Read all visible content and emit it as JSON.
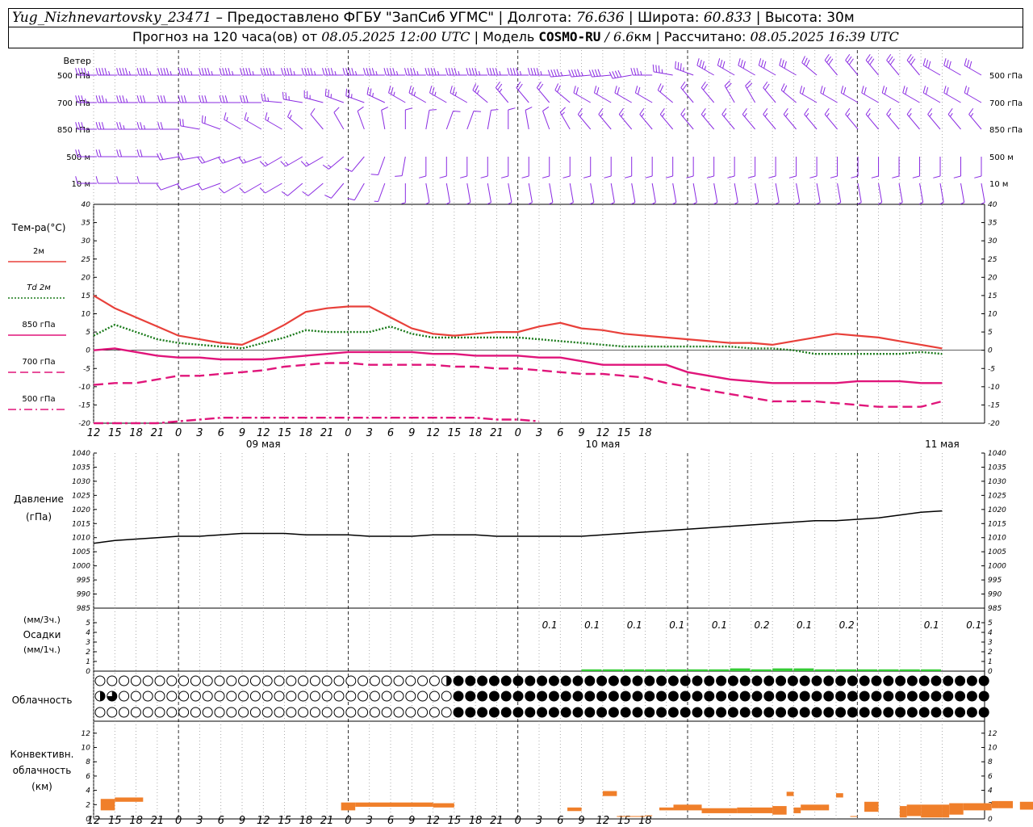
{
  "header": {
    "station": "Yug_Nizhnevartovsky_23471",
    "dash": "–",
    "provided_by": "Предоставлено ФГБУ \"ЗапСиб УГМС\"",
    "sep": "|",
    "lon_label": "Долгота:",
    "lon_value": "76.636",
    "lat_label": "Широта:",
    "lat_value": "60.833",
    "alt_label": "Высота:",
    "alt_value": "30м",
    "forecast_label": "Прогноз на 120 часа(ов) от",
    "forecast_from": "08.05.2025 12:00 UTC",
    "model_label": "Модель",
    "model_name": "COSMO-RU",
    "model_res": "/ 6.6",
    "model_res_unit": "км",
    "calc_label": "Рассчитано:",
    "calc_value": "08.05.2025 16:39 UTC"
  },
  "wind_panel": {
    "title": "Ветер",
    "levels": [
      "500 гПа",
      "700 гПа",
      "850 гПа",
      "500 м",
      "10 м"
    ]
  },
  "time_axis": {
    "hour_labels": [
      "12",
      "15",
      "18",
      "21",
      "0",
      "3",
      "6",
      "9",
      "12",
      "15",
      "18",
      "21",
      "0",
      "3",
      "6",
      "9",
      "12",
      "15",
      "18",
      "21",
      "0",
      "3",
      "6",
      "9",
      "12",
      "15",
      "18"
    ],
    "day_labels": [
      "09 мая",
      "10 мая",
      "11 мая"
    ]
  },
  "temp_legend": {
    "title": "Тем-ра(°С)",
    "items": [
      {
        "label": "2м",
        "color": "#e8403a",
        "dash": "solid"
      },
      {
        "label": "Td 2м",
        "color": "#1a7a1a",
        "dash": "dotted"
      },
      {
        "label": "850 гПа",
        "color": "#e0157a",
        "dash": "solid"
      },
      {
        "label": "700 гПа",
        "color": "#e0157a",
        "dash": "dash"
      },
      {
        "label": "500 гПа",
        "color": "#e0157a",
        "dash": "dashdot"
      }
    ]
  },
  "pressure_label_1": "Давление",
  "pressure_label_2": "(гПа)",
  "precip_labels": [
    "(мм/3ч.)",
    "Осадки",
    "(мм/1ч.)"
  ],
  "cloud_label": "Облачность",
  "conv_labels": [
    "Конвективн.",
    "облачность",
    "(км)"
  ],
  "colors": {
    "wind": "#8a2be2",
    "t2m": "#e8403a",
    "td2m": "#1a7a1a",
    "pmag": "#e0157a",
    "pressure": "#000000",
    "precip": "#33cc33",
    "conv": "#f07f2a"
  },
  "chart_data": [
    {
      "type": "line",
      "title": "Тем-ра(°С)",
      "x": [
        0,
        3,
        6,
        9,
        12,
        15,
        18,
        21,
        24,
        27,
        30,
        33,
        36,
        39,
        42,
        45,
        48,
        51,
        54,
        57,
        60,
        63,
        66,
        69,
        72,
        75,
        78,
        81,
        84,
        87,
        90,
        93,
        96,
        99,
        102,
        105,
        108,
        111,
        114,
        117,
        120
      ],
      "ylim": [
        -20,
        40
      ],
      "yticks": [
        -20,
        -15,
        -10,
        -5,
        0,
        5,
        10,
        15,
        20,
        25,
        30,
        35,
        40
      ],
      "series": [
        {
          "name": "2м",
          "values": [
            15,
            11.5,
            9,
            6.5,
            4,
            3,
            2,
            1.5,
            4,
            7,
            10.5,
            11.5,
            12,
            12,
            9,
            6,
            4.5,
            4,
            4.5,
            5,
            5,
            6.5,
            7.5,
            6,
            5.5,
            4.5,
            4,
            3.5,
            3,
            2.5,
            2,
            2,
            1.5,
            2.5,
            3.5,
            4.5,
            4,
            3.5,
            2.5,
            1.5,
            0.5
          ]
        },
        {
          "name": "Td 2м",
          "values": [
            4,
            7,
            5,
            3,
            2,
            1.5,
            1,
            0.5,
            2,
            3.5,
            5.5,
            5,
            5,
            5,
            6.5,
            4.5,
            3.5,
            3.5,
            3.5,
            3.5,
            3.5,
            3,
            2.5,
            2,
            1.5,
            1,
            1,
            1,
            1,
            1,
            1,
            0.5,
            0.5,
            0,
            -1,
            -1,
            -1,
            -1,
            -1,
            -0.5,
            -1
          ]
        },
        {
          "name": "850 гПа",
          "values": [
            0,
            0.5,
            -0.5,
            -1.5,
            -2,
            -2,
            -2.5,
            -2.5,
            -2.5,
            -2,
            -1.5,
            -1,
            -0.5,
            -0.5,
            -0.5,
            -0.5,
            -1,
            -1,
            -1.5,
            -1.5,
            -1.5,
            -2,
            -2,
            -3,
            -4,
            -4,
            -4,
            -4,
            -6,
            -7,
            -8,
            -8.5,
            -9,
            -9,
            -9,
            -9,
            -8.5,
            -8.5,
            -8.5,
            -9,
            -9
          ]
        },
        {
          "name": "700 гПа",
          "values": [
            -9.5,
            -9,
            -9,
            -8,
            -7,
            -7,
            -6.5,
            -6,
            -5.5,
            -4.5,
            -4,
            -3.5,
            -3.5,
            -4,
            -4,
            -4,
            -4,
            -4.5,
            -4.5,
            -5,
            -5,
            -5.5,
            -6,
            -6.5,
            -6.5,
            -7,
            -7.5,
            -9,
            -10,
            -11,
            -12,
            -13,
            -14,
            -14,
            -14,
            -14.5,
            -15,
            -15.5,
            -15.5,
            -15.5,
            -14
          ]
        },
        {
          "name": "500 гПа",
          "values": [
            -20,
            -20,
            -20,
            -20,
            -19.5,
            -19,
            -18.5,
            -18.5,
            -18.5,
            -18.5,
            -18.5,
            -18.5,
            -18.5,
            -18.5,
            -18.5,
            -18.5,
            -18.5,
            -18.5,
            -18.5,
            -19,
            -19,
            -19.5,
            null,
            null,
            null,
            null,
            null,
            null,
            null,
            null,
            null,
            null,
            null,
            null,
            null,
            null,
            null,
            null,
            null,
            null,
            null
          ]
        }
      ]
    },
    {
      "type": "line",
      "title": "Давление",
      "ylabel": "(гПа)",
      "x": [
        0,
        3,
        6,
        9,
        12,
        15,
        18,
        21,
        24,
        27,
        30,
        33,
        36,
        39,
        42,
        45,
        48,
        51,
        54,
        57,
        60,
        63,
        66,
        69,
        72,
        75,
        78,
        81,
        84,
        87,
        90,
        93,
        96,
        99,
        102,
        105,
        108,
        111,
        114,
        117,
        120
      ],
      "ylim": [
        985,
        1040
      ],
      "yticks": [
        985,
        990,
        995,
        1000,
        1005,
        1010,
        1015,
        1020,
        1025,
        1030,
        1035,
        1040
      ],
      "series": [
        {
          "name": "Давление",
          "values": [
            1008,
            1009,
            1009.5,
            1010,
            1010.5,
            1010.5,
            1011,
            1011.5,
            1011.5,
            1011.5,
            1011,
            1011,
            1011,
            1010.5,
            1010.5,
            1010.5,
            1011,
            1011,
            1011,
            1010.5,
            1010.5,
            1010.5,
            1010.5,
            1010.5,
            1011,
            1011.5,
            1012,
            1012.5,
            1013,
            1013.5,
            1014,
            1014.5,
            1015,
            1015.5,
            1016,
            1016,
            1016.5,
            1017,
            1018,
            1019,
            1019.5
          ]
        }
      ]
    },
    {
      "type": "bar",
      "title": "Осадки",
      "ylim": [
        0,
        5
      ],
      "yticks": [
        0,
        1,
        2,
        3,
        4,
        5
      ],
      "x": [
        69,
        72,
        75,
        78,
        81,
        84,
        87,
        90,
        93,
        96,
        99,
        102,
        105,
        108,
        111,
        114,
        117
      ],
      "values": [
        0.1,
        0.1,
        0.1,
        0.1,
        0.1,
        0.1,
        0.1,
        0.2,
        0.1,
        0.2,
        0.2,
        0.1,
        0.1,
        0.1,
        0.1,
        0.1,
        0.1
      ],
      "labels": [
        {
          "x": 70.5,
          "text": "0.1"
        },
        {
          "x": 76.5,
          "text": "0.1"
        },
        {
          "x": 82.5,
          "text": "0.1"
        },
        {
          "x": 88.5,
          "text": "0.1"
        },
        {
          "x": 94.5,
          "text": "0.1"
        },
        {
          "x": 100.5,
          "text": "0.2"
        },
        {
          "x": 106.5,
          "text": "0.1"
        },
        {
          "x": 112.5,
          "text": "0.2"
        },
        {
          "x": 124.5,
          "text": "0.1"
        },
        {
          "x": 130.5,
          "text": "0.1"
        }
      ]
    },
    {
      "type": "bar",
      "title": "Конвективн. облачность",
      "ylabel": "(км)",
      "ylim": [
        0,
        13
      ],
      "yticks": [
        0,
        2,
        4,
        6,
        8,
        10,
        12
      ],
      "segments": [
        {
          "x0": 1,
          "x1": 3,
          "lo": 1.2,
          "hi": 2.8
        },
        {
          "x0": 3,
          "x1": 7,
          "lo": 2.4,
          "hi": 3.0
        },
        {
          "x0": 35,
          "x1": 37,
          "lo": 1.2,
          "hi": 2.3
        },
        {
          "x0": 37,
          "x1": 48,
          "lo": 1.7,
          "hi": 2.3
        },
        {
          "x0": 48,
          "x1": 51,
          "lo": 1.6,
          "hi": 2.2
        },
        {
          "x0": 67,
          "x1": 69,
          "lo": 1.1,
          "hi": 1.6
        },
        {
          "x0": 72,
          "x1": 74,
          "lo": 3.2,
          "hi": 3.9
        },
        {
          "x0": 74,
          "x1": 78,
          "lo": 0.3,
          "hi": 0.4
        },
        {
          "x0": 78,
          "x1": 79,
          "lo": 0.4,
          "hi": 0.5
        },
        {
          "x0": 80,
          "x1": 82,
          "lo": 1.2,
          "hi": 1.6
        },
        {
          "x0": 82,
          "x1": 86,
          "lo": 1.2,
          "hi": 2.0
        },
        {
          "x0": 86,
          "x1": 91,
          "lo": 0.8,
          "hi": 1.5
        },
        {
          "x0": 91,
          "x1": 96,
          "lo": 0.8,
          "hi": 1.6
        },
        {
          "x0": 96,
          "x1": 98,
          "lo": 0.6,
          "hi": 1.8
        },
        {
          "x0": 98,
          "x1": 99,
          "lo": 3.2,
          "hi": 3.8
        },
        {
          "x0": 99,
          "x1": 100,
          "lo": 0.8,
          "hi": 1.6
        },
        {
          "x0": 100,
          "x1": 103,
          "lo": 1.2,
          "hi": 2.0
        },
        {
          "x0": 103,
          "x1": 104,
          "lo": 1.2,
          "hi": 2.0
        },
        {
          "x0": 105,
          "x1": 106,
          "lo": 3.0,
          "hi": 3.6
        },
        {
          "x0": 107,
          "x1": 108,
          "lo": 0.3,
          "hi": 0.4
        },
        {
          "x0": 109,
          "x1": 111,
          "lo": 1.0,
          "hi": 2.4
        },
        {
          "x0": 114,
          "x1": 115,
          "lo": 0.2,
          "hi": 1.8
        },
        {
          "x0": 115,
          "x1": 117,
          "lo": 0.4,
          "hi": 2.0
        },
        {
          "x0": 117,
          "x1": 120,
          "lo": 0.2,
          "hi": 2.0
        },
        {
          "x0": 120,
          "x1": 121,
          "lo": 0.2,
          "hi": 2.0
        },
        {
          "x0": 121,
          "x1": 123,
          "lo": 0.6,
          "hi": 2.2
        },
        {
          "x0": 123,
          "x1": 127,
          "lo": 1.2,
          "hi": 2.2
        },
        {
          "x0": 127,
          "x1": 128,
          "lo": 1.5,
          "hi": 2.5
        },
        {
          "x0": 128,
          "x1": 130,
          "lo": 1.5,
          "hi": 2.5
        },
        {
          "x0": 131,
          "x1": 133,
          "lo": 1.3,
          "hi": 2.4
        },
        {
          "x0": 133,
          "x1": 138,
          "lo": 1.3,
          "hi": 2.4
        },
        {
          "x0": 139,
          "x1": 140,
          "lo": 0.4,
          "hi": 1.2
        },
        {
          "x0": 143,
          "x1": 144,
          "lo": 1.8,
          "hi": 2.3
        }
      ]
    }
  ],
  "cloud_rows": [
    "0000000000000000000000000000000000000000000000000000000002448888888888888888888888888888888888888888888888888888888888888888888888888888888888888888888",
    "4665000000000000000000000000000000000000000000000000000000088888888888888888888888888888888888888888888888888888888888888888888888888888888888888888880",
    "0000000000000000000000000000000000000000000000000000000000068888888888888888888888888888888888888888888888888888888888888888888888888888888888888888888"
  ],
  "wind_barbs": {
    "500 гПа": {
      "dir": [
        270,
        270,
        270,
        270,
        270,
        270,
        270,
        270,
        270,
        270,
        270,
        270,
        270,
        270,
        270,
        270,
        270,
        270,
        270,
        270,
        270,
        270,
        270,
        265,
        265,
        265,
        260,
        270,
        280,
        290,
        300,
        300,
        300,
        300,
        300,
        310,
        320,
        320,
        320,
        320,
        320,
        300,
        300,
        300
      ],
      "speed": [
        45,
        45,
        45,
        45,
        45,
        45,
        45,
        45,
        45,
        45,
        45,
        45,
        45,
        45,
        45,
        45,
        45,
        45,
        45,
        45,
        45,
        45,
        45,
        45,
        45,
        40,
        40,
        35,
        35,
        35,
        35,
        30,
        30,
        30,
        30,
        30,
        30,
        30,
        30,
        30,
        30,
        30,
        30,
        30
      ]
    },
    "700 гПа": {
      "dir": [
        270,
        270,
        270,
        270,
        270,
        270,
        270,
        270,
        270,
        275,
        280,
        285,
        290,
        290,
        295,
        300,
        300,
        300,
        300,
        310,
        320,
        320,
        320,
        310,
        300,
        300,
        300,
        300,
        310,
        320,
        320,
        330,
        330,
        320,
        310,
        300,
        300,
        300,
        300,
        300,
        300,
        300,
        300,
        300
      ],
      "speed": [
        35,
        35,
        35,
        30,
        30,
        30,
        30,
        30,
        30,
        25,
        25,
        25,
        25,
        25,
        25,
        25,
        25,
        25,
        25,
        25,
        25,
        20,
        20,
        20,
        20,
        20,
        20,
        20,
        20,
        20,
        20,
        20,
        20,
        20,
        20,
        20,
        20,
        20,
        20,
        20,
        20,
        20,
        20,
        20
      ]
    },
    "850 гПа": {
      "dir": [
        270,
        270,
        270,
        270,
        270,
        280,
        290,
        300,
        300,
        300,
        310,
        320,
        330,
        340,
        350,
        0,
        10,
        20,
        20,
        10,
        0,
        350,
        340,
        330,
        320,
        320,
        320,
        320,
        320,
        320,
        320,
        320,
        320,
        320,
        320,
        320,
        320,
        320,
        320,
        320,
        320,
        320,
        320,
        320
      ],
      "speed": [
        30,
        30,
        25,
        25,
        20,
        20,
        20,
        15,
        15,
        15,
        15,
        10,
        10,
        10,
        10,
        10,
        10,
        10,
        10,
        10,
        10,
        10,
        10,
        15,
        15,
        15,
        15,
        15,
        15,
        15,
        15,
        15,
        15,
        15,
        15,
        15,
        15,
        15,
        15,
        15,
        15,
        15,
        15,
        15
      ]
    },
    "500 м": {
      "dir": [
        270,
        270,
        270,
        270,
        260,
        260,
        250,
        250,
        250,
        240,
        240,
        240,
        230,
        220,
        200,
        190,
        180,
        180,
        180,
        180,
        180,
        180,
        180,
        180,
        180,
        180,
        180,
        180,
        180,
        180,
        180,
        180,
        180,
        180,
        180,
        180,
        180,
        180,
        180,
        180,
        180,
        180,
        180,
        180
      ],
      "speed": [
        20,
        20,
        20,
        20,
        20,
        20,
        20,
        15,
        15,
        15,
        15,
        15,
        15,
        10,
        10,
        10,
        10,
        10,
        10,
        10,
        10,
        10,
        10,
        10,
        10,
        10,
        10,
        10,
        10,
        10,
        10,
        10,
        10,
        10,
        10,
        10,
        10,
        10,
        10,
        10,
        10,
        10,
        10,
        10
      ]
    },
    "10 м": {
      "dir": [
        270,
        270,
        270,
        270,
        250,
        250,
        250,
        240,
        240,
        240,
        230,
        230,
        220,
        210,
        200,
        180,
        170,
        170,
        170,
        170,
        170,
        170,
        170,
        170,
        170,
        170,
        170,
        170,
        170,
        170,
        170,
        170,
        170,
        170,
        170,
        170,
        170,
        170,
        170,
        170,
        170,
        170,
        170,
        170
      ],
      "speed": [
        10,
        10,
        10,
        10,
        10,
        10,
        10,
        10,
        10,
        10,
        10,
        10,
        10,
        10,
        5,
        5,
        5,
        5,
        5,
        5,
        5,
        5,
        5,
        5,
        5,
        5,
        5,
        5,
        5,
        5,
        5,
        5,
        5,
        5,
        5,
        5,
        5,
        5,
        5,
        5,
        5,
        5,
        5,
        5
      ]
    }
  }
}
